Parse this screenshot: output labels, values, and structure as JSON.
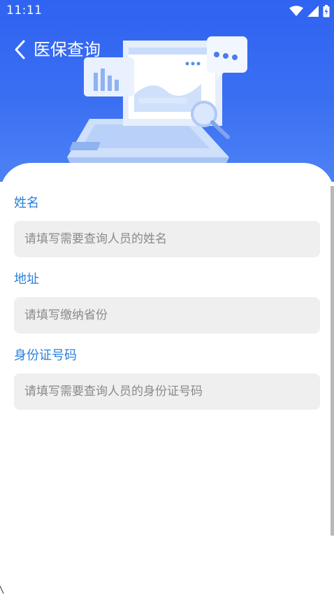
{
  "status_bar": {
    "time": "11:11",
    "icons": [
      "wifi-icon",
      "signal-icon",
      "battery-charging-icon"
    ]
  },
  "header": {
    "title": "医保查询",
    "back_icon": "chevron-left-icon",
    "illustration": "laptop-search-illustration",
    "colors": {
      "top": "#2f63f1",
      "bottom": "#4d82f5"
    }
  },
  "form": {
    "name": {
      "label": "姓名",
      "placeholder": "请填写需要查询人员的姓名",
      "value": ""
    },
    "address": {
      "label": "地址",
      "placeholder": "请填写缴纳省份",
      "value": ""
    },
    "id_number": {
      "label": "身份证号码",
      "placeholder": "请填写需要查询人员的身份证号码",
      "value": ""
    }
  },
  "colors": {
    "label": "#2a7fdc",
    "input_bg": "#efefef",
    "placeholder": "#8a8a8a"
  }
}
